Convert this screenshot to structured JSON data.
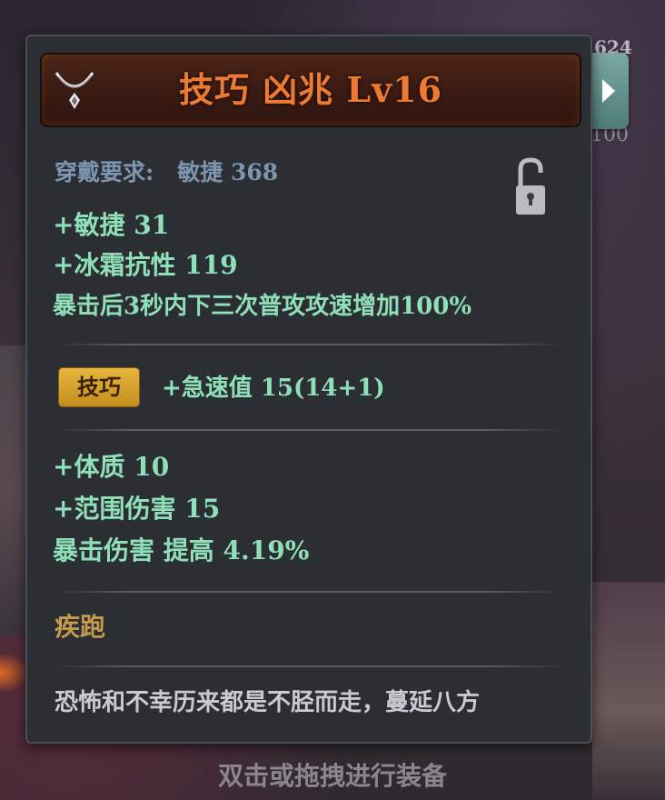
{
  "background": {
    "number_top": "624",
    "number_bottom": "100"
  },
  "item": {
    "title": "技巧 凶兆 Lv16",
    "icon": "necklace-icon",
    "title_color": "#ee7a32"
  },
  "requirement": {
    "label": "穿戴要求:",
    "value": "敏捷 368",
    "lock_icon": "unlocked-padlock-icon"
  },
  "base_stats": [
    "+敏捷 31",
    "+冰霜抗性 119",
    "暴击后3秒内下三次普攻攻速增加100%"
  ],
  "set_bonus": {
    "badge": "技巧",
    "text": "+急速值 15(14+1)",
    "badge_color": "#d9a52e"
  },
  "extra_stats": [
    "+体质 10",
    "+范围伤害 15",
    "暴击伤害 提高 4.19%"
  ],
  "skill": {
    "name": "疾跑",
    "color": "#c59a4e"
  },
  "flavor_text": "恐怖和不幸历来都是不胫而走，蔓延八方",
  "hint": "双击或拖拽进行装备",
  "colors": {
    "stat_green": "#8fe0b8",
    "requirement_blue": "#7e95b0",
    "panel_bg": "#2b2e33"
  }
}
